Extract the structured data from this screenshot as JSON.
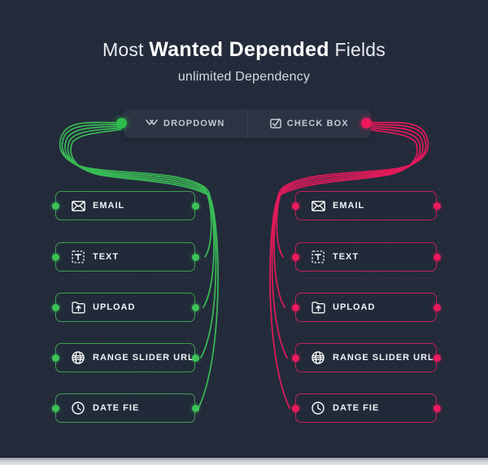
{
  "heading": {
    "title_pre": "Most ",
    "title_strong": "Wanted Depended",
    "title_post": " Fields",
    "subtitle": "unlimited Dependency"
  },
  "tabs": [
    {
      "label": "DROPDOWN",
      "icon": "chevron-double-down-icon",
      "endpoint_color": "#2fbd4e"
    },
    {
      "label": "CHECK BOX",
      "icon": "checkbox-checked-icon",
      "endpoint_color": "#ec1a5c"
    }
  ],
  "columns": [
    {
      "name": "dropdown-column",
      "accent": "#3fa055",
      "node_color": "#3cc257",
      "fields": [
        {
          "label": "EMAIL",
          "icon": "envelope-icon"
        },
        {
          "label": "TEXT",
          "icon": "text-box-icon"
        },
        {
          "label": "UPLOAD",
          "icon": "upload-icon"
        },
        {
          "label": "RANGE SLIDER URL",
          "icon": "globe-icon"
        },
        {
          "label": "DATE FIE",
          "icon": "clock-icon"
        }
      ]
    },
    {
      "name": "checkbox-column",
      "accent": "#c0215a",
      "node_color": "#ec1a5c",
      "fields": [
        {
          "label": "EMAIL",
          "icon": "envelope-icon"
        },
        {
          "label": "TEXT",
          "icon": "text-box-icon"
        },
        {
          "label": "UPLOAD",
          "icon": "upload-icon"
        },
        {
          "label": "RANGE SLIDER URL",
          "icon": "globe-icon"
        },
        {
          "label": "DATE FIE",
          "icon": "clock-icon"
        }
      ]
    }
  ],
  "colors": {
    "background": "#232b3b",
    "panel": "#2c3444",
    "green": "#3cc257",
    "pink": "#ec1a5c",
    "text": "#f2f3f6"
  }
}
